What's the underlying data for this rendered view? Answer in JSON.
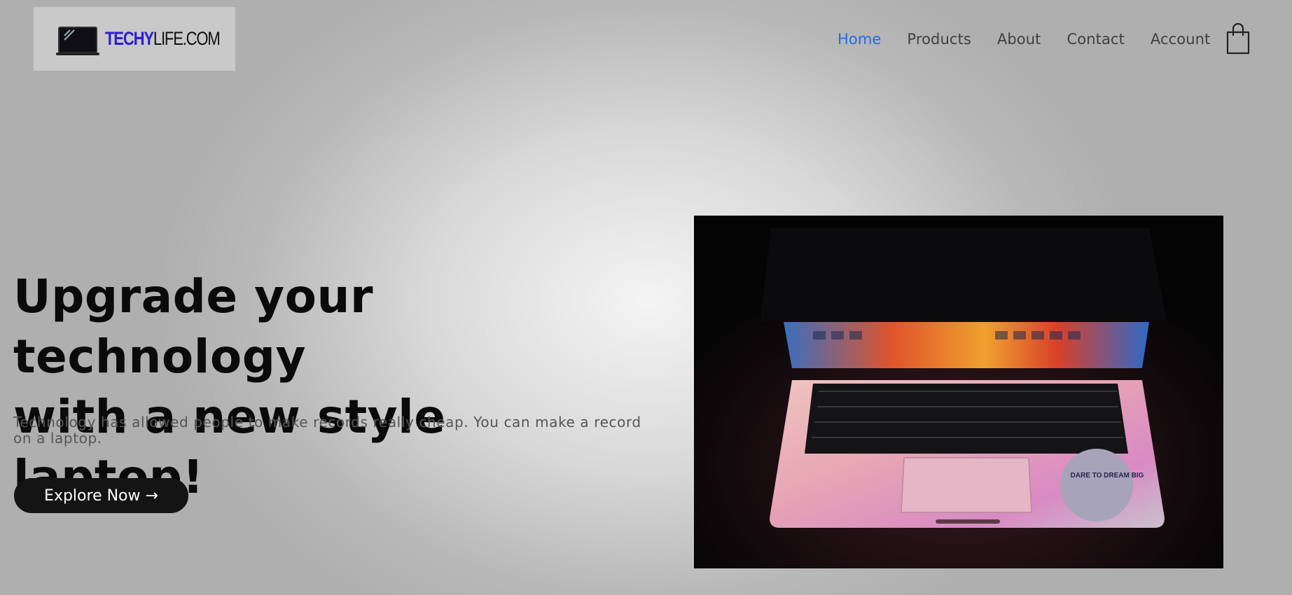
{
  "brand": {
    "part1": "TECHY",
    "part2": "LIFE.COM"
  },
  "nav": {
    "home": "Home",
    "products": "Products",
    "about": "About",
    "contact": "Contact",
    "account": "Account",
    "cart_icon": "shopping-bag-icon"
  },
  "hero": {
    "title_line1": "Upgrade your technology",
    "title_line2": "with a new style laptop!",
    "subtitle": "Technology has allowed people to make records really cheap. You can make a record on a laptop.",
    "cta": "Explore Now →",
    "sticker_text": "DARE TO DREAM BIG"
  },
  "colors": {
    "accent": "#1f6fe6",
    "brand_blue": "#2a1fd6",
    "button_bg": "#141414"
  }
}
